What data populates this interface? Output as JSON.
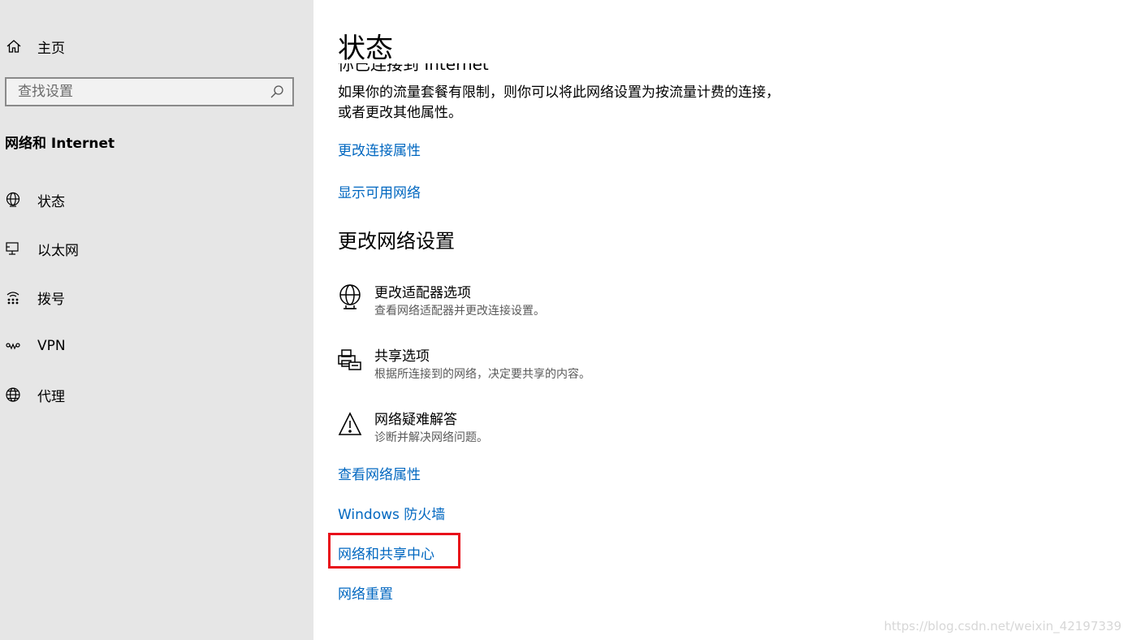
{
  "sidebar": {
    "home": {
      "label": "主页",
      "icon": "home-icon"
    },
    "search": {
      "placeholder": "查找设置",
      "icon": "search-icon"
    },
    "section_title": "网络和 Internet",
    "items": [
      {
        "label": "状态",
        "icon": "globe-status-icon"
      },
      {
        "label": "以太网",
        "icon": "ethernet-icon"
      },
      {
        "label": "拨号",
        "icon": "dialup-icon"
      },
      {
        "label": "VPN",
        "icon": "vpn-icon"
      },
      {
        "label": "代理",
        "icon": "globe-proxy-icon"
      }
    ]
  },
  "main": {
    "title": "状态",
    "clipped_text": "你已连接到 Internet",
    "description": "如果你的流量套餐有限制，则你可以将此网络设置为按流量计费的连接，或者更改其他属性。",
    "links_top": [
      "更改连接属性",
      "显示可用网络"
    ],
    "section_heading": "更改网络设置",
    "options": [
      {
        "title": "更改适配器选项",
        "subtitle": "查看网络适配器并更改连接设置。",
        "icon": "adapter-globe-icon"
      },
      {
        "title": "共享选项",
        "subtitle": "根据所连接到的网络，决定要共享的内容。",
        "icon": "sharing-printer-icon"
      },
      {
        "title": "网络疑难解答",
        "subtitle": "诊断并解决网络问题。",
        "icon": "warning-icon"
      }
    ],
    "links_bottom": [
      "查看网络属性",
      "Windows 防火墙",
      "网络和共享中心",
      "网络重置"
    ]
  },
  "highlight_color": "#e8101a",
  "link_color": "#0067c0",
  "watermark": "https://blog.csdn.net/weixin_42197339"
}
